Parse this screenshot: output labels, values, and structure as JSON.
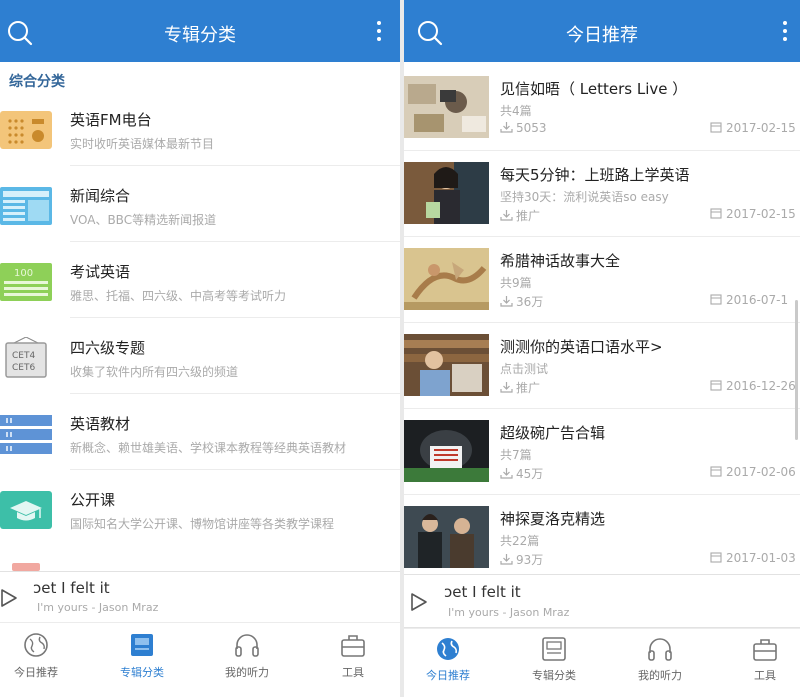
{
  "left": {
    "header": {
      "title": "专辑分类"
    },
    "section_label": "综合分类",
    "categories": [
      {
        "name": "英语FM电台",
        "desc": "实时收听英语媒体最新节目",
        "icon": "radio-icon"
      },
      {
        "name": "新闻综合",
        "desc": "VOA、BBC等精选新闻报道",
        "icon": "newspaper-icon"
      },
      {
        "name": "考试英语",
        "desc": "雅思、托福、四六级、中高考等考试听力",
        "icon": "exam-paper-icon",
        "icon_text": "100"
      },
      {
        "name": "四六级专题",
        "desc": "收集了软件内所有四六级的频道",
        "icon": "cet-sign-icon",
        "icon_text": [
          "CET4",
          "CET6"
        ]
      },
      {
        "name": "英语教材",
        "desc": "新概念、赖世雄美语、学校课本教程等经典英语教材",
        "icon": "bookshelf-icon"
      },
      {
        "name": "公开课",
        "desc": "国际知名大学公开课、博物馆讲座等各类教学课程",
        "icon": "graduation-cap-icon"
      }
    ],
    "player": {
      "title": "ɔet I felt it",
      "artist": "I'm yours - Jason Mraz"
    },
    "tabs": [
      {
        "label": "今日推荐",
        "icon": "globe-icon",
        "active": false
      },
      {
        "label": "专辑分类",
        "icon": "album-icon",
        "active": true
      },
      {
        "label": "我的听力",
        "icon": "headphones-icon",
        "active": false
      },
      {
        "label": "工具",
        "icon": "toolbox-icon",
        "active": false
      }
    ]
  },
  "right": {
    "header": {
      "title": "今日推荐"
    },
    "items": [
      {
        "title": "见信如晤（ Letters Live ）",
        "sub": "共4篇",
        "count": "5053",
        "date": "2017-02-15"
      },
      {
        "title": "每天5分钟：上班路上学英语",
        "sub": "坚持30天：流利说英语so easy",
        "count": "推广",
        "date": "2017-02-15"
      },
      {
        "title": "希腊神话故事大全",
        "sub": "共9篇",
        "count": "36万",
        "date": "2016-07-1"
      },
      {
        "title": "测测你的英语口语水平>",
        "sub": "点击测试",
        "count": "推广",
        "date": "2016-12-26"
      },
      {
        "title": "超级碗广告合辑",
        "sub": "共7篇",
        "count": "45万",
        "date": "2017-02-06"
      },
      {
        "title": "神探夏洛克精选",
        "sub": "共22篇",
        "count": "93万",
        "date": "2017-01-03"
      }
    ],
    "player": {
      "title": "ɔet I felt it",
      "artist": "I'm yours - Jason Mraz"
    },
    "tabs": [
      {
        "label": "今日推荐",
        "icon": "globe-icon",
        "active": true
      },
      {
        "label": "专辑分类",
        "icon": "album-icon",
        "active": false
      },
      {
        "label": "我的听力",
        "icon": "headphones-icon",
        "active": false
      },
      {
        "label": "工具",
        "icon": "toolbox-icon",
        "active": false
      }
    ]
  },
  "colors": {
    "primary": "#2e7fd1",
    "text": "#222222",
    "muted": "#aaaaaa",
    "section": "#336699"
  }
}
